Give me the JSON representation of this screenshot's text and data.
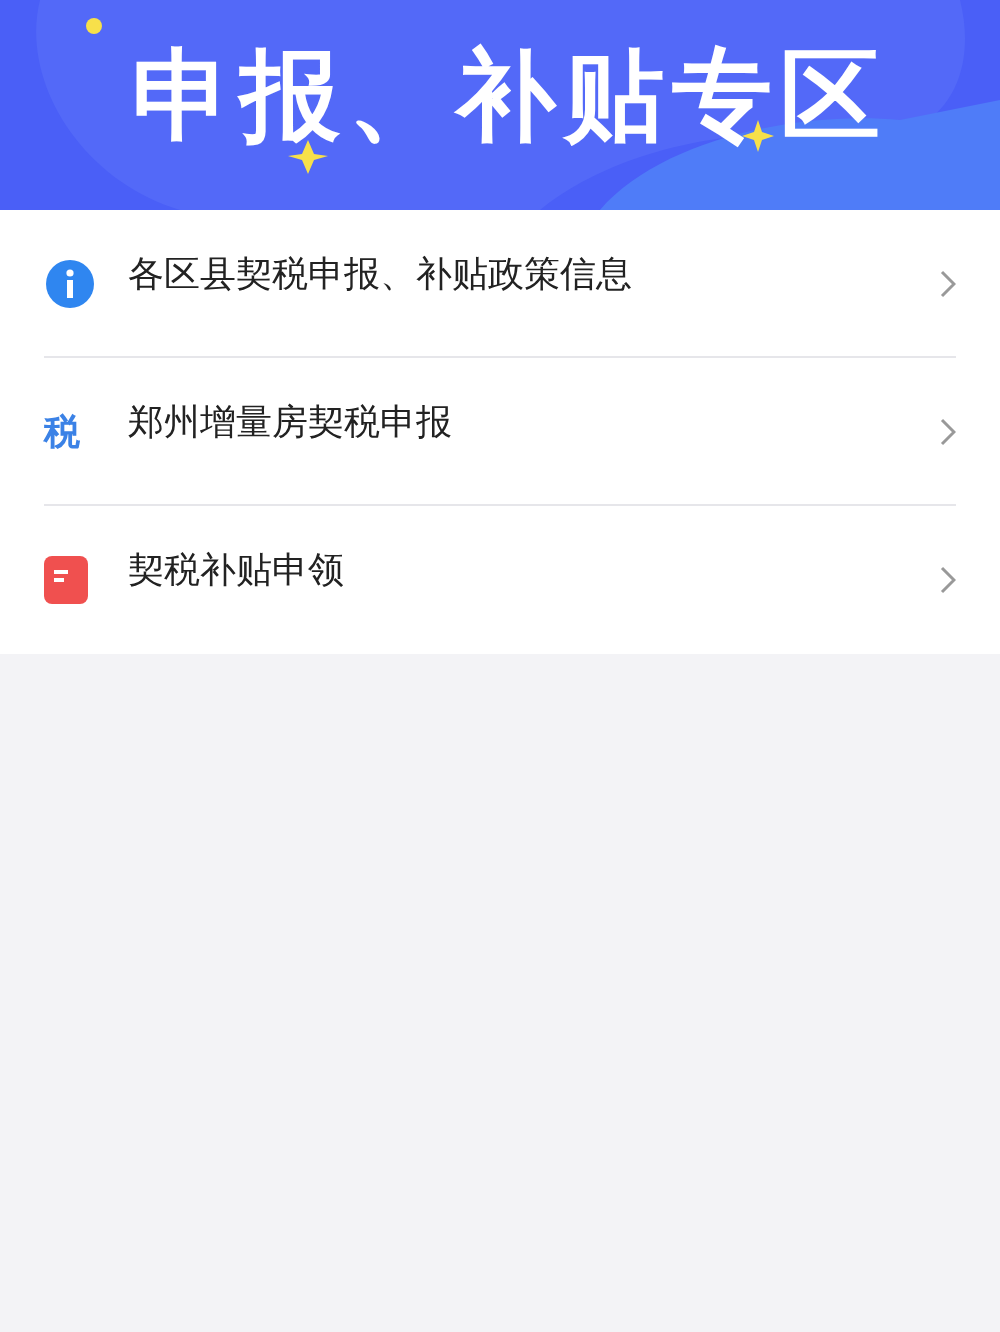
{
  "banner": {
    "title": "申报、补贴专区"
  },
  "menu": [
    {
      "kind": "info",
      "label": "各区县契税申报、补贴政策信息"
    },
    {
      "kind": "glyph",
      "glyph": "税",
      "label": "郑州增量房契税申报"
    },
    {
      "kind": "doc",
      "label": "契税补贴申领"
    }
  ]
}
